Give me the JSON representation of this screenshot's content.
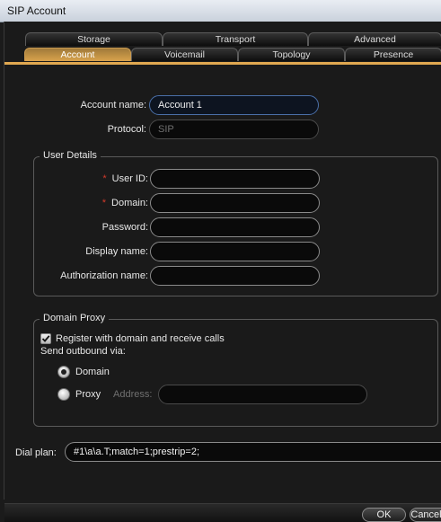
{
  "window": {
    "title": "SIP Account"
  },
  "tabs": {
    "row1": [
      "Storage",
      "Transport",
      "Advanced"
    ],
    "row2": [
      "Account",
      "Voicemail",
      "Topology",
      "Presence"
    ],
    "active": "Account"
  },
  "account": {
    "name_label": "Account name:",
    "name_value": "Account 1",
    "protocol_label": "Protocol:",
    "protocol_value": "SIP"
  },
  "user_details": {
    "title": "User Details",
    "required_mark": "*",
    "user_id_label": "User ID:",
    "domain_label": "Domain:",
    "password_label": "Password:",
    "display_name_label": "Display name:",
    "auth_name_label": "Authorization name:"
  },
  "domain_proxy": {
    "title": "Domain Proxy",
    "register_label": "Register with domain and receive calls",
    "register_checked": true,
    "send_via_label": "Send outbound via:",
    "domain_option": "Domain",
    "proxy_option": "Proxy",
    "address_label": "Address:",
    "selected": "Domain"
  },
  "dial_plan": {
    "label": "Dial plan:",
    "value": "#1\\a\\a.T;match=1;prestrip=2;"
  },
  "buttons": {
    "ok": "OK",
    "cancel": "Cancel"
  }
}
